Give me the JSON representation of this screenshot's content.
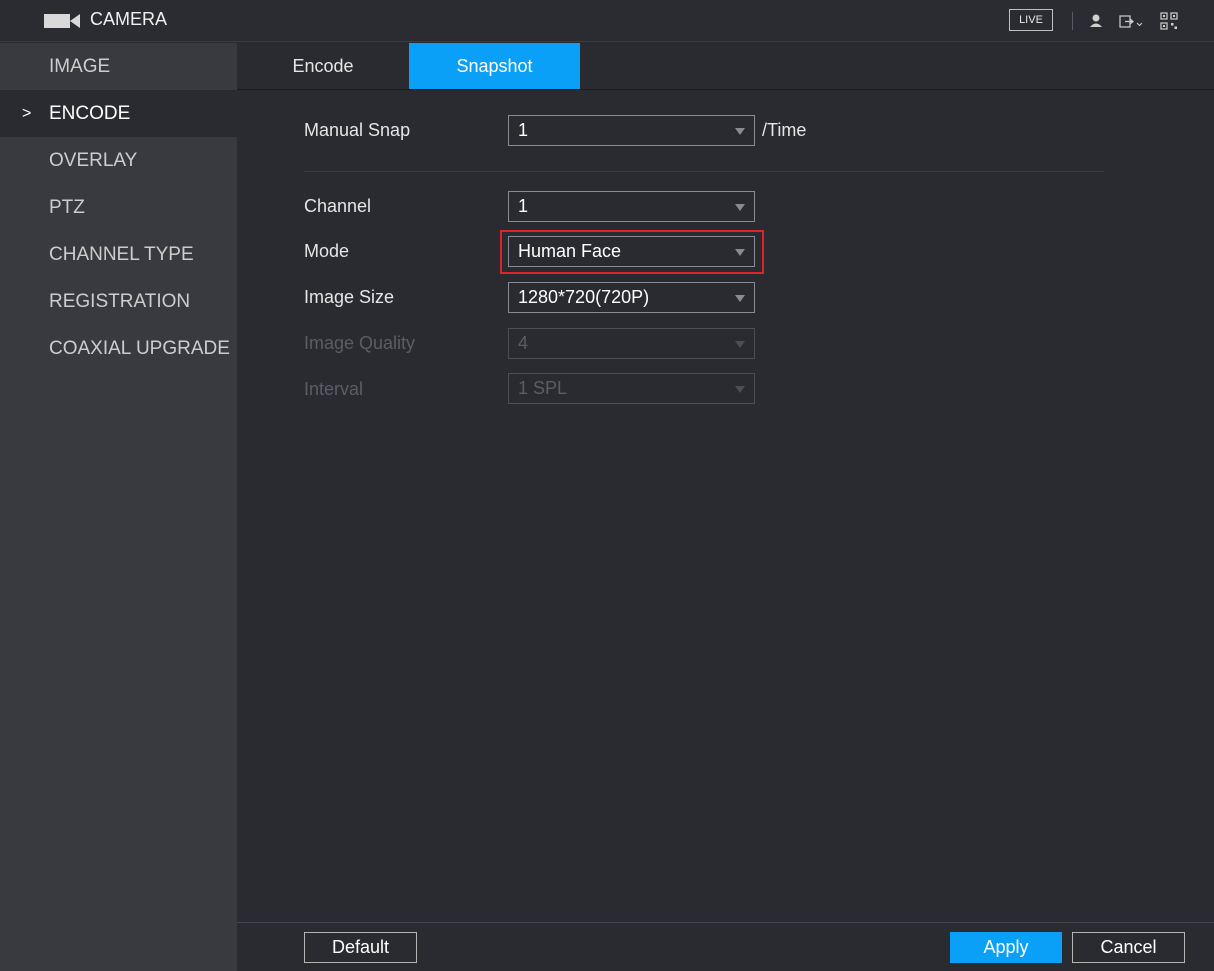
{
  "header": {
    "title": "CAMERA",
    "icon": "camera-icon",
    "live_label": "LIVE",
    "right_icons": [
      "user-icon",
      "logout-icon",
      "qr-code-icon"
    ]
  },
  "sidebar": {
    "items": [
      {
        "label": "IMAGE",
        "active": false
      },
      {
        "label": "ENCODE",
        "active": true
      },
      {
        "label": "OVERLAY",
        "active": false
      },
      {
        "label": "PTZ",
        "active": false
      },
      {
        "label": "CHANNEL TYPE",
        "active": false
      },
      {
        "label": "REGISTRATION",
        "active": false
      },
      {
        "label": "COAXIAL UPGRADE",
        "active": false
      }
    ],
    "active_marker": ">"
  },
  "tabs": [
    {
      "label": "Encode",
      "active": false
    },
    {
      "label": "Snapshot",
      "active": true
    }
  ],
  "form": {
    "manual_snap": {
      "label": "Manual Snap",
      "value": "1",
      "unit": "/Time"
    },
    "channel": {
      "label": "Channel",
      "value": "1"
    },
    "mode": {
      "label": "Mode",
      "value": "Human Face"
    },
    "image_size": {
      "label": "Image Size",
      "value": "1280*720(720P)"
    },
    "image_quality": {
      "label": "Image Quality",
      "value": "4",
      "disabled": true
    },
    "interval": {
      "label": "Interval",
      "value": "1 SPL",
      "disabled": true
    }
  },
  "buttons": {
    "default_label": "Default",
    "apply_label": "Apply",
    "cancel_label": "Cancel"
  },
  "colors": {
    "accent": "#0aa0f7",
    "highlight_box": "#e0232b",
    "background": "#2a2b31",
    "sidebar": "#393a40"
  }
}
